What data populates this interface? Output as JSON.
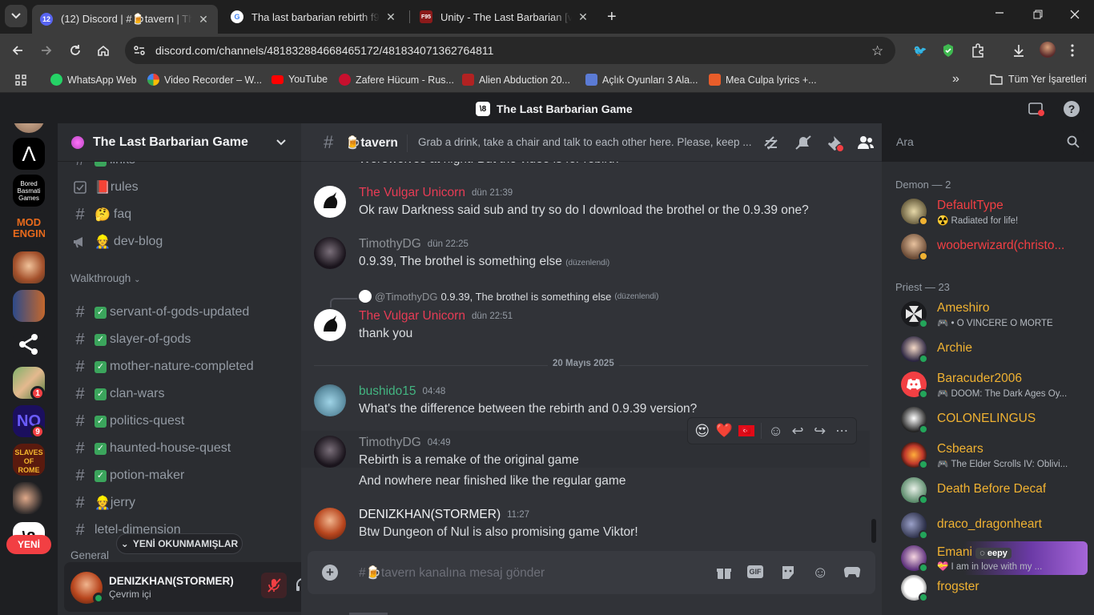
{
  "browser": {
    "tabs": [
      {
        "title": "(12) Discord | #🍺tavern | The L",
        "fav_text": "12",
        "fav_color": "#5865f2"
      },
      {
        "title": "Tha last barbarian rebirth f95 - G",
        "fav_text": "G",
        "fav_color": "#ffffff"
      },
      {
        "title": "Unity - The Last Barbarian [v0.9",
        "fav_text": "F95",
        "fav_color": "#8b1a1a"
      }
    ],
    "url": "discord.com/channels/481832884668465172/481834071362764811",
    "bookmarks": [
      {
        "label": "WhatsApp Web",
        "color": "#25d366"
      },
      {
        "label": "Video Recorder – W...",
        "color": "#4285f4"
      },
      {
        "label": "YouTube",
        "color": "#ff0000"
      },
      {
        "label": "Zafere Hücum - Rus...",
        "color": "#c8102e"
      },
      {
        "label": "Alien Abduction 20...",
        "color": "#b22222"
      },
      {
        "label": "Açlık Oyunları 3 Ala...",
        "color": "#5b7bd5"
      },
      {
        "label": "Mea Culpa lyrics +...",
        "color": "#e85d2a"
      }
    ],
    "all_bookmarks": "Tüm Yer İşaretleri"
  },
  "app_title": "The Last Barbarian Game",
  "rail": {
    "badges": [
      "1",
      "9"
    ],
    "new_label": "YENİ"
  },
  "server": {
    "name": "The Last Barbarian Game",
    "channels_top": [
      {
        "name": "links",
        "prefix": "✅",
        "icon": "hash"
      },
      {
        "name": "rules",
        "prefix": "📕",
        "icon": "rules"
      },
      {
        "name": "faq",
        "prefix": "🤔",
        "icon": "hash"
      },
      {
        "name": "dev-blog",
        "prefix": "👷",
        "icon": "announce"
      }
    ],
    "category": "Walkthrough",
    "channels_walk": [
      {
        "name": "servant-of-gods-updated",
        "check": true
      },
      {
        "name": "slayer-of-gods",
        "check": true
      },
      {
        "name": "mother-nature-completed",
        "check": true
      },
      {
        "name": "clan-wars",
        "check": true
      },
      {
        "name": "politics-quest",
        "check": true
      },
      {
        "name": "haunted-house-quest",
        "check": true
      },
      {
        "name": "potion-maker",
        "check": true
      },
      {
        "name": "jerry",
        "check": false,
        "emoji": "👷"
      },
      {
        "name": "letel-dimension",
        "check": false
      }
    ],
    "category2": "General",
    "unread_label": "YENİ OKUNMAMIŞLAR"
  },
  "user": {
    "name": "DENIZKHAN(STORMER)",
    "status": "Çevrim içi"
  },
  "channel": {
    "name": "tavern",
    "emoji": "🍺",
    "topic": "Grab a drink, take a chair and talk to each other here. Please, keep ...",
    "search_placeholder": "Ara",
    "input_placeholder": "#🍺tavern kanalına mesaj gönder"
  },
  "messages": {
    "cut_top": "Werewolves at night. But the video is for rebirth",
    "m1": {
      "author": "The Vulgar Unicorn",
      "time": "dün 21:39",
      "text": "Ok raw Darkness said sub and try so do I download the brothel or the 0.9.39 one?",
      "color": "#e73c55"
    },
    "m2": {
      "author": "TimothyDG",
      "time": "dün 22:25",
      "text": "0.9.39, The brothel is something else",
      "edited": "(düzenlendi)",
      "color": "#8e9297"
    },
    "m3": {
      "reply_author": "@TimothyDG",
      "reply_text": "0.9.39, The brothel is something else",
      "reply_edited": "(düzenlendi)",
      "author": "The Vulgar Unicorn",
      "time": "dün 22:51",
      "text": "thank you",
      "color": "#e73c55"
    },
    "divider": "20 Mayıs 2025",
    "m4": {
      "author": "bushido15",
      "time": "04:48",
      "text": "What's the difference between the rebirth and 0.9.39 version?",
      "color": "#43b581"
    },
    "m5": {
      "author": "TimothyDG",
      "time": "04:49",
      "text": "Rebirth is a remake of the original game",
      "text2": "And nowhere near finished like the regular game",
      "color": "#8e9297"
    },
    "m6": {
      "author": "DENIZKHAN(STORMER)",
      "time": "11:27",
      "text": "Btw Dungeon of Nul is also promising game Viktor!",
      "color": "#f2f3f5"
    }
  },
  "reactions_bar": [
    "😍",
    "❤️",
    "🇹🇷"
  ],
  "members": {
    "groups": [
      {
        "title": "Demon — 2",
        "color": "#f23f43",
        "items": [
          {
            "name": "DefaultType",
            "status": "☢️ Radiated for life!"
          },
          {
            "name": "wooberwizard(christo...",
            "status": ""
          }
        ]
      },
      {
        "title": "Priest — 23",
        "color": "#f0b232",
        "items": [
          {
            "name": "Ameshiro",
            "status": "• O VINCERE O MORTE"
          },
          {
            "name": "Archie",
            "status": ""
          },
          {
            "name": "Baracuder2006",
            "status": "DOOM: The Dark Ages Oy..."
          },
          {
            "name": "COLONELINGUS",
            "status": ""
          },
          {
            "name": "Csbears",
            "status": "The Elder Scrolls IV: Oblivi..."
          },
          {
            "name": "Death Before Decaf",
            "status": ""
          },
          {
            "name": "draco_dragonheart",
            "status": ""
          },
          {
            "name": "Emani",
            "status": "💝 I am in love with my ...",
            "tag": "eepy"
          },
          {
            "name": "frogster",
            "status": ""
          }
        ]
      }
    ]
  },
  "colors": {
    "demon": "#f23f43",
    "priest": "#f0b232",
    "accent": "#5865f2",
    "online": "#23a55a"
  }
}
